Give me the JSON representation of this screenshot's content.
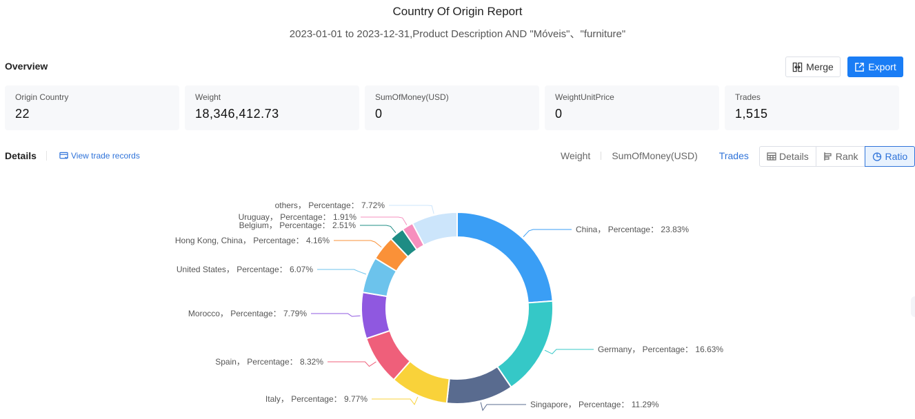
{
  "header": {
    "title": "Country Of Origin Report",
    "subtitle": "2023-01-01 to 2023-12-31,Product Description AND \"Móveis\"、\"furniture\""
  },
  "overview": {
    "label": "Overview",
    "merge_label": "Merge",
    "export_label": "Export",
    "cards": [
      {
        "label": "Origin Country",
        "value": "22"
      },
      {
        "label": "Weight",
        "value": "18,346,412.73"
      },
      {
        "label": "SumOfMoney(USD)",
        "value": "0"
      },
      {
        "label": "WeightUnitPrice",
        "value": "0"
      },
      {
        "label": "Trades",
        "value": "1,515"
      }
    ]
  },
  "details": {
    "label": "Details",
    "view_trade_records": "View trade records",
    "metric_tabs": [
      {
        "label": "Weight",
        "active": false
      },
      {
        "label": "SumOfMoney(USD)",
        "active": false
      },
      {
        "label": "Trades",
        "active": true
      }
    ],
    "view_tabs": [
      {
        "label": "Details",
        "icon": "table-icon",
        "active": false
      },
      {
        "label": "Rank",
        "icon": "bar-rank-icon",
        "active": false
      },
      {
        "label": "Ratio",
        "icon": "pie-chart-icon",
        "active": true
      }
    ]
  },
  "colors": {
    "accent": "#1a7df5",
    "link": "#2f73d9"
  },
  "chart_data": {
    "type": "pie",
    "variant": "donut",
    "label_format": "{name}， Percentage： {value}%",
    "label_prefix": "Percentage",
    "slices": [
      {
        "name": "China",
        "value": 23.83,
        "color": "#3a9ef5"
      },
      {
        "name": "Germany",
        "value": 16.63,
        "color": "#35c8c7"
      },
      {
        "name": "Singapore",
        "value": 11.29,
        "color": "#596b8f"
      },
      {
        "name": "Italy",
        "value": 9.77,
        "color": "#f9d23a"
      },
      {
        "name": "Spain",
        "value": 8.32,
        "color": "#ef5f7a"
      },
      {
        "name": "Morocco",
        "value": 7.79,
        "color": "#8f58e0"
      },
      {
        "name": "United States",
        "value": 6.07,
        "color": "#6cc3ec"
      },
      {
        "name": "Hong Kong, China",
        "value": 4.16,
        "color": "#fa9138"
      },
      {
        "name": "Belgium",
        "value": 2.51,
        "color": "#1e8c84"
      },
      {
        "name": "Uruguay",
        "value": 1.91,
        "color": "#f68fbe"
      },
      {
        "name": "others",
        "value": 7.72,
        "color": "#cce5fb"
      }
    ]
  }
}
